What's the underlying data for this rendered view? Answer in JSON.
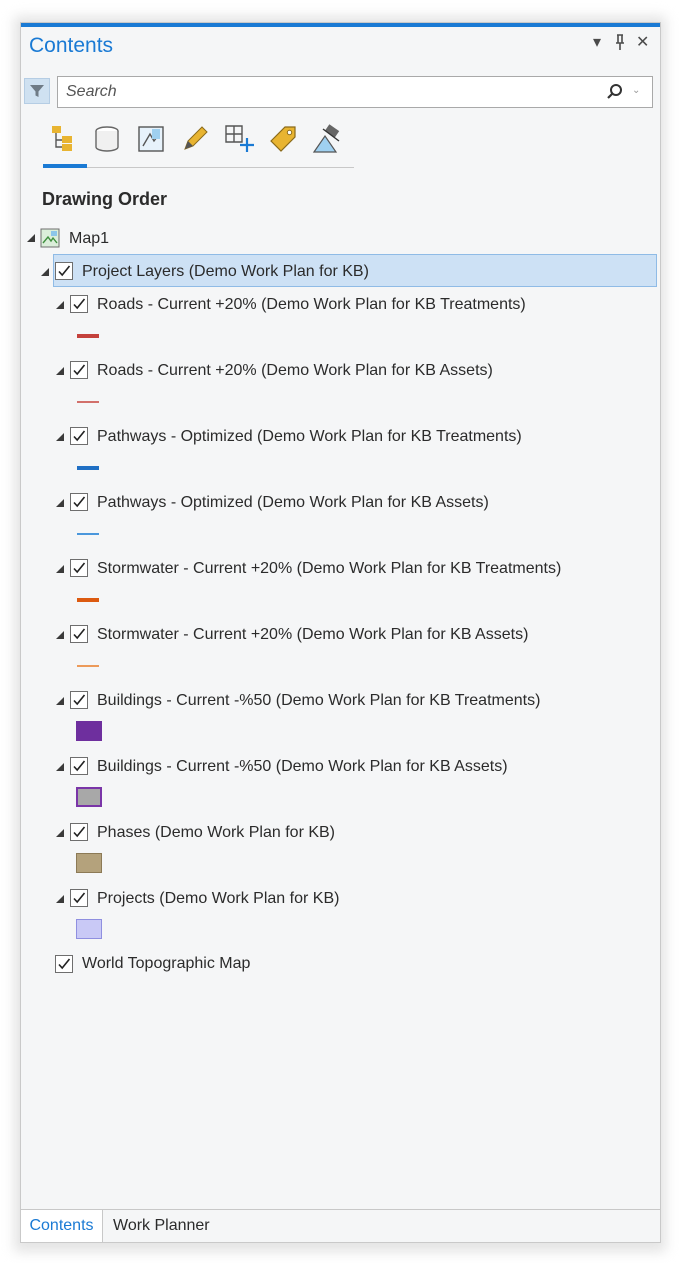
{
  "panel": {
    "title": "Contents",
    "controls": {
      "menu": "▾",
      "pin": "⊥",
      "close": "✕"
    }
  },
  "search": {
    "placeholder": "Search",
    "value": ""
  },
  "toolbar": {
    "icons": [
      "list-by-drawing-order-icon",
      "list-by-source-icon",
      "list-by-selection-icon",
      "list-by-editing-icon",
      "list-by-snapping-icon",
      "list-by-labeling-icon",
      "list-by-perspective-imagery-icon"
    ],
    "selected": 0
  },
  "section_title": "Drawing Order",
  "tree": {
    "map": {
      "label": "Map1"
    },
    "group": {
      "label": "Project Layers (Demo Work Plan for KB)",
      "checked": true,
      "selected": true
    },
    "layers": [
      {
        "label": "Roads - Current +20% (Demo Work Plan for KB Treatments)",
        "checked": true,
        "symbol": "line-thick",
        "color": "#c4413c"
      },
      {
        "label": "Roads - Current +20% (Demo Work Plan for KB Assets)",
        "checked": true,
        "symbol": "line-thin",
        "color": "#d2706b"
      },
      {
        "label": "Pathways - Optimized (Demo Work Plan for KB Treatments)",
        "checked": true,
        "symbol": "line-thick",
        "color": "#1f6fc4"
      },
      {
        "label": "Pathways - Optimized (Demo Work Plan for KB Assets)",
        "checked": true,
        "symbol": "line-thin",
        "color": "#4a97dc"
      },
      {
        "label": "Stormwater - Current +20% (Demo Work Plan for KB Treatments)",
        "checked": true,
        "symbol": "line-thick",
        "color": "#dc5a10"
      },
      {
        "label": "Stormwater - Current +20% (Demo Work Plan for KB Assets)",
        "checked": true,
        "symbol": "line-thin",
        "color": "#ec9a5a"
      },
      {
        "label": "Buildings - Current -%50 (Demo Work Plan for KB Treatments)",
        "checked": true,
        "symbol": "fill",
        "color": "#6e2f9e",
        "outline": "#6e2f9e"
      },
      {
        "label": "Buildings - Current -%50 (Demo Work Plan for KB Assets)",
        "checked": true,
        "symbol": "fill",
        "color": "#a8a8a8",
        "outline": "#7a35a8"
      },
      {
        "label": "Phases (Demo Work Plan for KB)",
        "checked": true,
        "symbol": "fill",
        "color": "#b4a27c",
        "outline": "#8c7a56"
      },
      {
        "label": "Projects (Demo Work Plan for KB)",
        "checked": true,
        "symbol": "fill",
        "color": "#c9c9f6",
        "outline": "#8f8fe0"
      }
    ],
    "basemap": {
      "label": "World Topographic Map",
      "checked": true
    }
  },
  "tabs": [
    {
      "label": "Contents",
      "active": true
    },
    {
      "label": "Work Planner",
      "active": false
    }
  ]
}
